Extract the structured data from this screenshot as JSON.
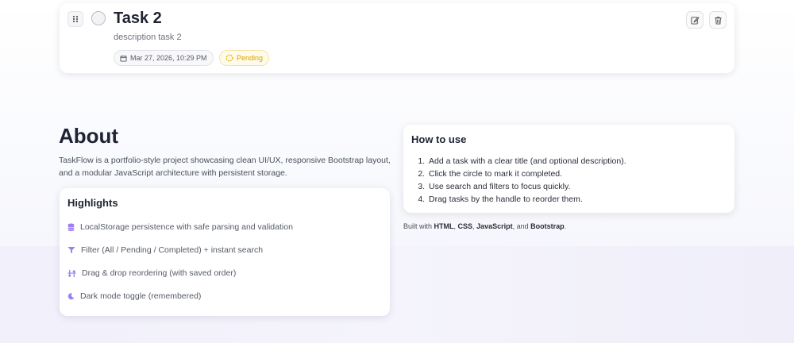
{
  "task": {
    "title": "Task 2",
    "description": "description task 2",
    "date": "Mar 27, 2026, 10:29 PM",
    "status": "Pending",
    "icons": {
      "drag": "drag-handle-icon",
      "check": "circle-icon",
      "calendar": "calendar-icon",
      "status": "spinner-icon",
      "edit": "edit-icon",
      "delete": "trash-icon"
    }
  },
  "about": {
    "title": "About",
    "text": "TaskFlow is a portfolio-style project showcasing clean UI/UX, responsive Bootstrap layout, and a modular JavaScript architecture with persistent storage."
  },
  "highlights": {
    "heading": "Highlights",
    "items": [
      {
        "icon": "database-icon",
        "text": "LocalStorage persistence with safe parsing and validation"
      },
      {
        "icon": "filter-icon",
        "text": "Filter (All / Pending / Completed) + instant search"
      },
      {
        "icon": "drag-reorder-icon",
        "text": "Drag & drop reordering (with saved order)"
      },
      {
        "icon": "moon-icon",
        "text": "Dark mode toggle (remembered)"
      }
    ]
  },
  "howto": {
    "heading": "How to use",
    "steps": [
      "Add a task with a clear title (and optional description).",
      "Click the circle to mark it completed.",
      "Use search and filters to focus quickly.",
      "Drag tasks by the handle to reorder them."
    ]
  },
  "built_with": {
    "prefix": "Built with ",
    "tech": [
      "HTML",
      "CSS",
      "JavaScript",
      "Bootstrap"
    ],
    "sep1": ", ",
    "sep2": ", ",
    "sep3": ", and ",
    "suffix": "."
  },
  "colors": {
    "accent": "#8b6cf0",
    "pending": "#d6a200",
    "text": "#1f2333"
  }
}
